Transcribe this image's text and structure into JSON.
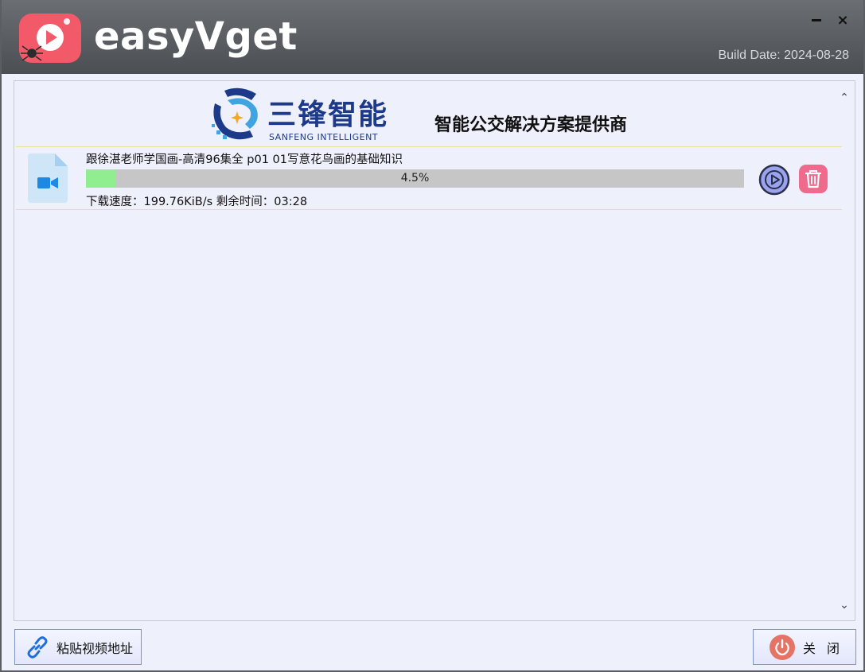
{
  "window": {
    "app_name": "easyVget",
    "build_date": "Build Date: 2024-08-28",
    "controls": {
      "minimize": "minimize",
      "close": "×"
    }
  },
  "banner": {
    "logo_cn": "三锋智能",
    "logo_en": "SANFENG INTELLIGENT",
    "tagline": "智能公交解决方案提供商"
  },
  "downloads": [
    {
      "title": "跟徐湛老师学国画-高清96集全 p01 01写意花鸟画的基础知识",
      "progress_percent": 4.5,
      "progress_label": "4.5%",
      "status": "下载速度：199.76KiB/s 剩余时间：03:28",
      "file_icon": "video-file-icon",
      "actions": [
        "play-icon",
        "trash-icon"
      ]
    }
  ],
  "footer": {
    "paste_label": "粘贴视频地址",
    "paste_icon": "link-icon",
    "close_label": "关闭",
    "close_icon": "power-icon"
  },
  "colors": {
    "titlebar": "#55585c",
    "panel_bg": "#eef0fb",
    "progress_fill": "#90ee90",
    "progress_track": "#c6c6c6",
    "play_accent": "#8b95e6",
    "delete_accent": "#ef6b8e",
    "logo_red": "#f25a6a"
  }
}
